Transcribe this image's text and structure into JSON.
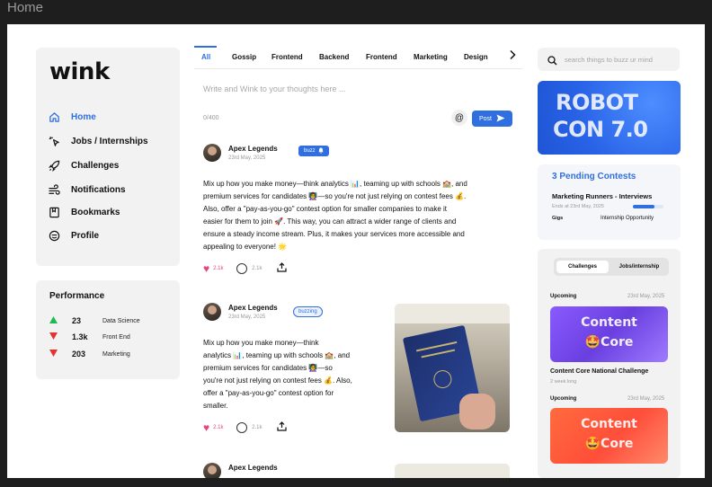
{
  "window": {
    "title": "Home"
  },
  "brand": {
    "logo": "wink",
    "accent": "#2f6fe0"
  },
  "sidebar": {
    "items": [
      {
        "label": "Home",
        "icon": "home-icon",
        "active": true
      },
      {
        "label": "Jobs / Internships",
        "icon": "cursor-click-icon"
      },
      {
        "label": "Challenges",
        "icon": "rocket-icon"
      },
      {
        "label": "Notifications",
        "icon": "wind-icon"
      },
      {
        "label": "Bookmarks",
        "icon": "bookmark-icon"
      },
      {
        "label": "Profile",
        "icon": "smiley-icon"
      }
    ]
  },
  "performance": {
    "title": "Performance",
    "rows": [
      {
        "trend": "up",
        "value": "23",
        "category": "Data Science"
      },
      {
        "trend": "down",
        "value": "1.3k",
        "category": "Front End"
      },
      {
        "trend": "down",
        "value": "203",
        "category": "Marketing"
      }
    ]
  },
  "feed": {
    "tabs": [
      "All",
      "Gossip",
      "Frontend",
      "Backend",
      "Frontend",
      "Marketing",
      "Design"
    ],
    "active_tab": "All",
    "compose": {
      "placeholder": "Write and Wink to your thoughts here ...",
      "counter": "0/400",
      "mention_label": "@",
      "post_label": "Post"
    },
    "posts": [
      {
        "author": "Apex Legends",
        "date": "23rd May, 2025",
        "tag": "buzz",
        "lines": [
          "Mix up how you make money—think analytics 📊, teaming up with schools 🏫, and",
          "premium services for candidates 👩‍🏫—so you're not just relying on contest fees 💰.",
          "Also, offer a \"pay-as-you-go\" contest option for smaller companies to make it",
          "easier for them to join 🚀. This way, you can attract a wider range of clients and",
          "ensure a steady income stream. Plus, it makes your services more accessible and",
          "appealing to everyone! 🌟"
        ],
        "likes": "2.1k",
        "comments": "2.1k"
      },
      {
        "author": "Apex Legends",
        "date": "23rd May, 2025",
        "tag": "buzzing",
        "lines": [
          "Mix up how you make money—think",
          "analytics 📊, teaming up with schools 🏫, and",
          "premium services for candidates 👩‍🏫—so",
          "you're not just relying on contest fees 💰. Also,",
          "offer a \"pay-as-you-go\" contest option for",
          "smaller."
        ],
        "likes": "2.1k",
        "comments": "2.1k"
      },
      {
        "author": "Apex Legends"
      }
    ]
  },
  "right": {
    "search_placeholder": "search things to buzz ur mind",
    "banner": {
      "line1": "ROBOT",
      "line2": "CON 7.0"
    },
    "contests": {
      "title": "3 Pending Contests",
      "name": "Marketing Runners - Interviews",
      "ends": "Ends at 23rd May, 2025",
      "progress": 0.7,
      "tag": "Gigs",
      "type": "Internship Opportunity"
    },
    "challenges": {
      "tabs": [
        "Challenges",
        "Jobs/internship"
      ],
      "items": [
        {
          "status": "Upcoming",
          "date": "23rd May, 2025",
          "line1": "Content",
          "line2": "🤩Core",
          "name": "Content Core National Challenge",
          "duration": "2 week long",
          "style": "purple"
        },
        {
          "status": "Upcoming",
          "date": "23rd May, 2025",
          "line1": "Content",
          "line2": "🤩Core",
          "style": "orange"
        }
      ]
    }
  }
}
